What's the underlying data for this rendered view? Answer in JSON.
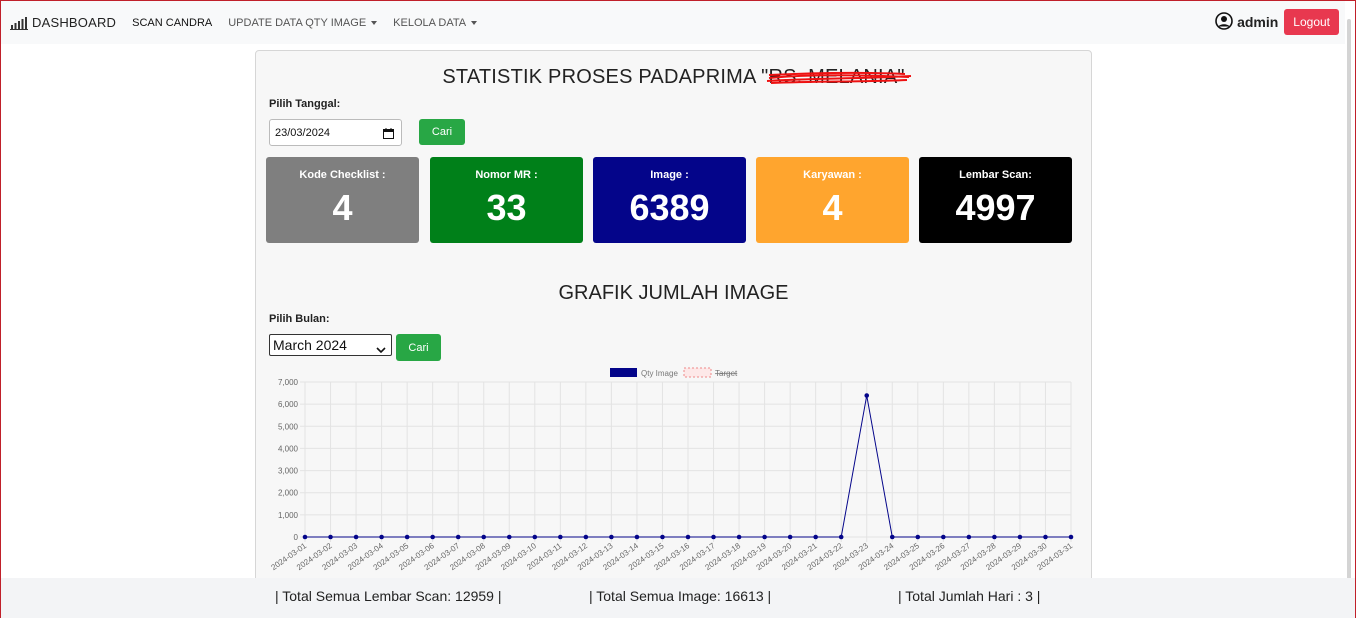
{
  "navbar": {
    "brand": "DASHBOARD",
    "links": [
      {
        "label": "SCAN CANDRA"
      },
      {
        "label": "UPDATE DATA QTY IMAGE"
      },
      {
        "label": "KELOLA DATA"
      }
    ],
    "user": "admin",
    "logout_label": "Logout"
  },
  "main": {
    "title_prefix": "STATISTIK PROSES PADAPRIMA",
    "title_redacted": "\"RS. MELANIA\"",
    "date_label": "Pilih Tanggal:",
    "date_value": "23/03/2024",
    "search_label": "Cari",
    "stats": [
      {
        "label": "Kode Checklist :",
        "value": "4",
        "color": "#7f7f7f"
      },
      {
        "label": "Nomor MR :",
        "value": "33",
        "color": "#008019"
      },
      {
        "label": "Image :",
        "value": "6389",
        "color": "#04058a"
      },
      {
        "label": "Karyawan :",
        "value": "4",
        "color": "#ffa52e"
      },
      {
        "label": "Lembar Scan:",
        "value": "4997",
        "color": "#000000"
      }
    ],
    "chart_title": "GRAFIK JUMLAH IMAGE",
    "month_label": "Pilih Bulan:",
    "month_value": "March 2024",
    "month_search_label": "Cari"
  },
  "chart_data": {
    "type": "line",
    "x": [
      "2024-03-01",
      "2024-03-02",
      "2024-03-03",
      "2024-03-04",
      "2024-03-05",
      "2024-03-06",
      "2024-03-07",
      "2024-03-08",
      "2024-03-09",
      "2024-03-10",
      "2024-03-11",
      "2024-03-12",
      "2024-03-13",
      "2024-03-14",
      "2024-03-15",
      "2024-03-16",
      "2024-03-17",
      "2024-03-18",
      "2024-03-19",
      "2024-03-20",
      "2024-03-21",
      "2024-03-22",
      "2024-03-23",
      "2024-03-24",
      "2024-03-25",
      "2024-03-26",
      "2024-03-27",
      "2024-03-28",
      "2024-03-29",
      "2024-03-30",
      "2024-03-31"
    ],
    "series": [
      {
        "name": "Qty Image",
        "color": "#04058a",
        "values": [
          0,
          0,
          0,
          0,
          0,
          0,
          0,
          0,
          0,
          0,
          0,
          0,
          0,
          0,
          0,
          0,
          0,
          0,
          0,
          0,
          0,
          0,
          6389,
          0,
          0,
          0,
          0,
          0,
          0,
          0,
          0
        ]
      }
    ],
    "legend": [
      "Qty Image",
      "Target"
    ],
    "legend_position": "top",
    "ylim": [
      0,
      7000
    ],
    "y_ticks": [
      "0",
      "1,000",
      "2,000",
      "3,000",
      "4,000",
      "5,000",
      "6,000",
      "7,000"
    ],
    "grid": true
  },
  "footer": {
    "total_scan": "| Total Semua Lembar Scan: 12959 |",
    "total_image": "| Total Semua Image: 16613 |",
    "total_days": "| Total Jumlah Hari : 3 |"
  },
  "icons": {
    "brand": "bar-chart-icon",
    "user": "user-circle-icon",
    "calendar": "calendar-icon"
  }
}
